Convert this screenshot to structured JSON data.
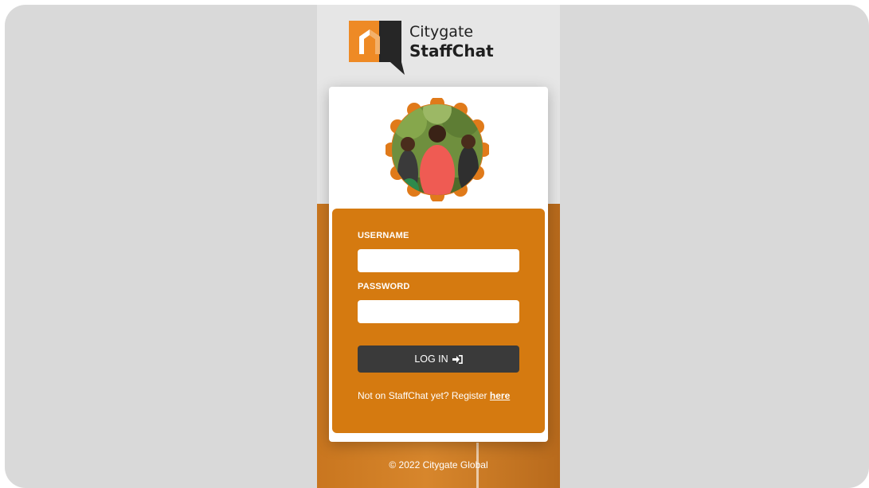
{
  "logo": {
    "line1": "Citygate",
    "line2": "StaffChat"
  },
  "form": {
    "username_label": "USERNAME",
    "username_value": "",
    "password_label": "PASSWORD",
    "password_value": "",
    "login_label": "LOG IN",
    "register_prefix": "Not on StaffChat yet? Register",
    "register_link": "here"
  },
  "footer": {
    "text": "© 2022 Citygate Global"
  },
  "colors": {
    "accent": "#d57a10",
    "button": "#3a3a3a",
    "background": "#d9d9d9"
  },
  "icons": {
    "login": "sign-in-icon"
  }
}
